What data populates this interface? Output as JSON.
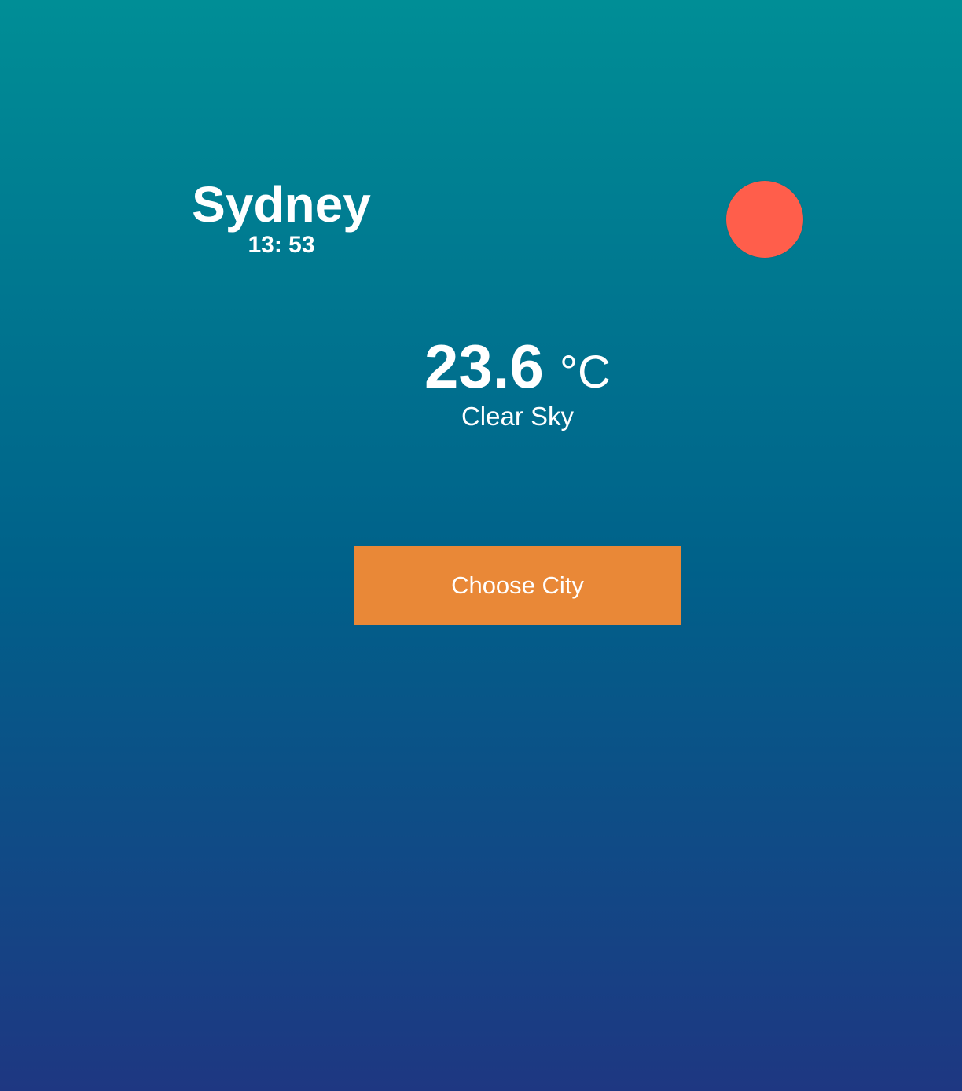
{
  "location": {
    "city": "Sydney",
    "time": "13: 53"
  },
  "weather": {
    "temperature": "23.6",
    "unit": "°C",
    "condition": "Clear Sky",
    "icon": "sun-icon"
  },
  "actions": {
    "choose_city_label": "Choose City"
  },
  "colors": {
    "gradient_top": "#008e96",
    "gradient_middle": "#00618a",
    "gradient_bottom": "#1e3782",
    "sun": "#ff5e4b",
    "button": "#e98837",
    "text": "#ffffff"
  }
}
